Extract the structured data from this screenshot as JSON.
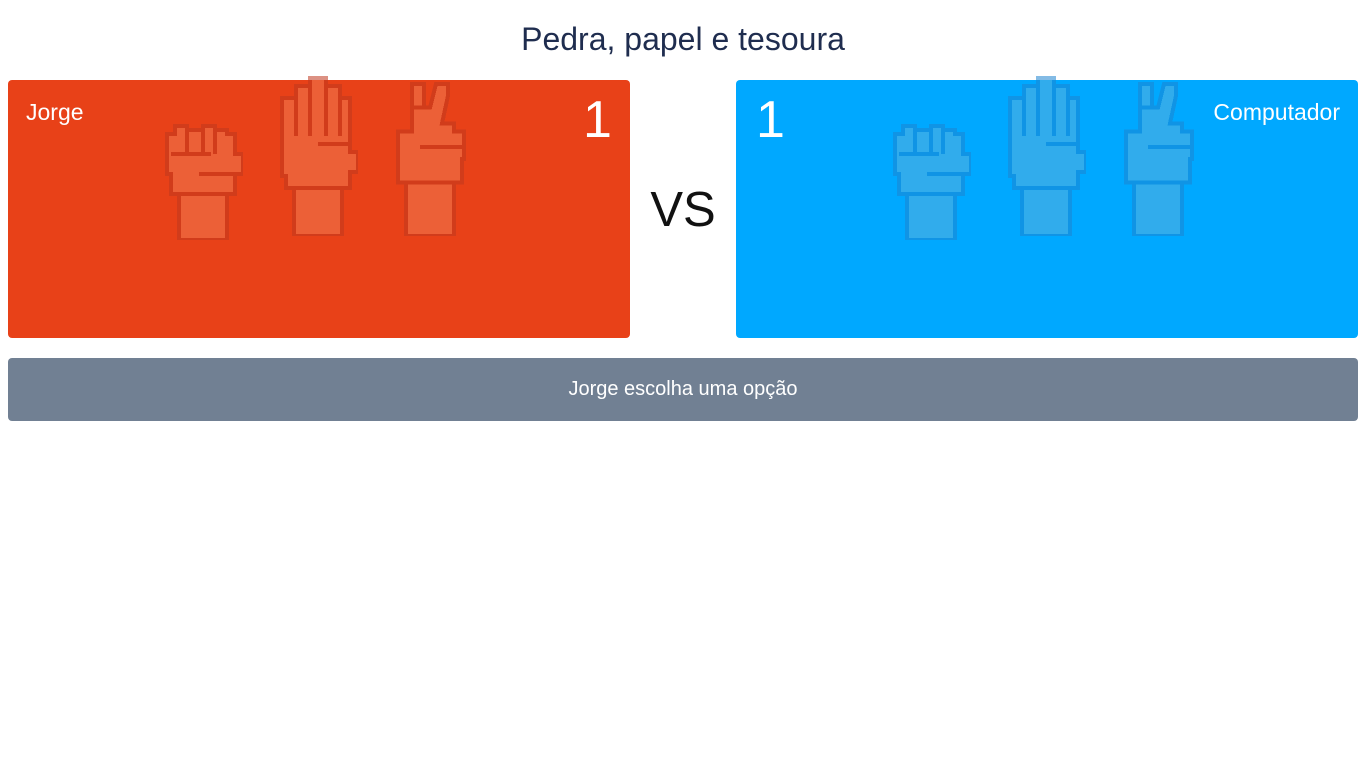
{
  "title": "Pedra, papel e tesoura",
  "player": {
    "name": "Jorge",
    "score": "1",
    "color": "#e84118"
  },
  "computer": {
    "name": "Computador",
    "score": "1",
    "color": "#00a8ff"
  },
  "vs_label": "VS",
  "status_message": "Jorge escolha uma opção",
  "status_color": "#718093",
  "icons": [
    "rock-hand-icon",
    "paper-hand-icon",
    "scissors-hand-icon"
  ]
}
